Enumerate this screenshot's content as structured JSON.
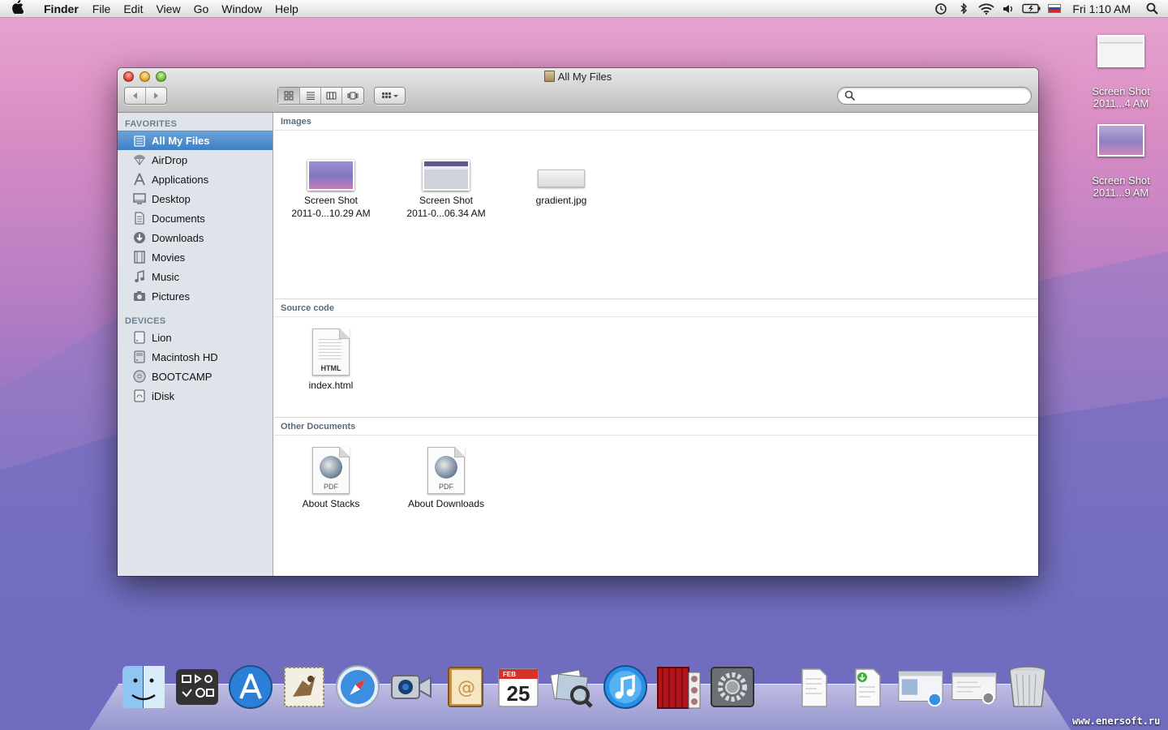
{
  "menubar": {
    "app_name": "Finder",
    "menus": [
      "File",
      "Edit",
      "View",
      "Go",
      "Window",
      "Help"
    ],
    "clock": "Fri 1:10 AM",
    "status_icons": [
      "time-machine-icon",
      "bluetooth-icon",
      "wifi-icon",
      "volume-icon",
      "battery-icon",
      "input-flag-icon",
      "spotlight-icon"
    ]
  },
  "desktop": {
    "icons": [
      {
        "line1": "Screen Shot",
        "line2": "2011...4 AM"
      },
      {
        "line1": "Screen Shot",
        "line2": "2011...9 AM"
      }
    ]
  },
  "window": {
    "title": "All My Files",
    "search": {
      "value": "",
      "placeholder": ""
    }
  },
  "sidebar": {
    "favorites_header": "FAVORITES",
    "favorites": [
      {
        "label": "All My Files",
        "icon": "all-my-files-icon",
        "selected": true
      },
      {
        "label": "AirDrop",
        "icon": "airdrop-icon"
      },
      {
        "label": "Applications",
        "icon": "applications-icon"
      },
      {
        "label": "Desktop",
        "icon": "desktop-icon"
      },
      {
        "label": "Documents",
        "icon": "documents-icon"
      },
      {
        "label": "Downloads",
        "icon": "downloads-icon"
      },
      {
        "label": "Movies",
        "icon": "movies-icon"
      },
      {
        "label": "Music",
        "icon": "music-icon"
      },
      {
        "label": "Pictures",
        "icon": "pictures-icon"
      }
    ],
    "devices_header": "DEVICES",
    "devices": [
      {
        "label": "Lion",
        "icon": "disk-icon"
      },
      {
        "label": "Macintosh HD",
        "icon": "hard-disk-icon"
      },
      {
        "label": "BOOTCAMP",
        "icon": "optical-disk-icon"
      },
      {
        "label": "iDisk",
        "icon": "idisk-icon"
      }
    ]
  },
  "content": {
    "groups": [
      {
        "header": "Images",
        "files": [
          {
            "line1": "Screen Shot",
            "line2": "2011-0...10.29 AM",
            "kind": "screenshot"
          },
          {
            "line1": "Screen Shot",
            "line2": "2011-0...06.34 AM",
            "kind": "screenshot-window"
          },
          {
            "line1": "gradient.jpg",
            "line2": "",
            "kind": "gradient"
          }
        ]
      },
      {
        "header": "Source code",
        "files": [
          {
            "line1": "index.html",
            "line2": "",
            "kind": "html",
            "tag": "HTML"
          }
        ]
      },
      {
        "header": "Other Documents",
        "files": [
          {
            "line1": "About Stacks",
            "line2": "",
            "kind": "pdf",
            "tag": "PDF"
          },
          {
            "line1": "About Downloads",
            "line2": "",
            "kind": "pdf",
            "tag": "PDF"
          }
        ]
      }
    ]
  },
  "dock": {
    "apps": [
      "finder-icon",
      "dashboard-icon",
      "app-store-icon",
      "mail-icon",
      "safari-icon",
      "facetime-icon",
      "address-book-icon",
      "ical-icon",
      "preview-icon",
      "itunes-icon",
      "photo-booth-icon",
      "system-preferences-icon"
    ],
    "ical_month": "FEB",
    "ical_day": "25",
    "stacks": [
      "document-stack-icon",
      "downloads-stack-icon",
      "screenshot-stack-icon",
      "screenshot-stack-2-icon",
      "trash-icon"
    ]
  },
  "watermark": "www.enersoft.ru",
  "colors": {
    "selection": "#3f7fc4",
    "sidebar_bg": "#dee4ea",
    "group_header": "#5b6a7a"
  }
}
